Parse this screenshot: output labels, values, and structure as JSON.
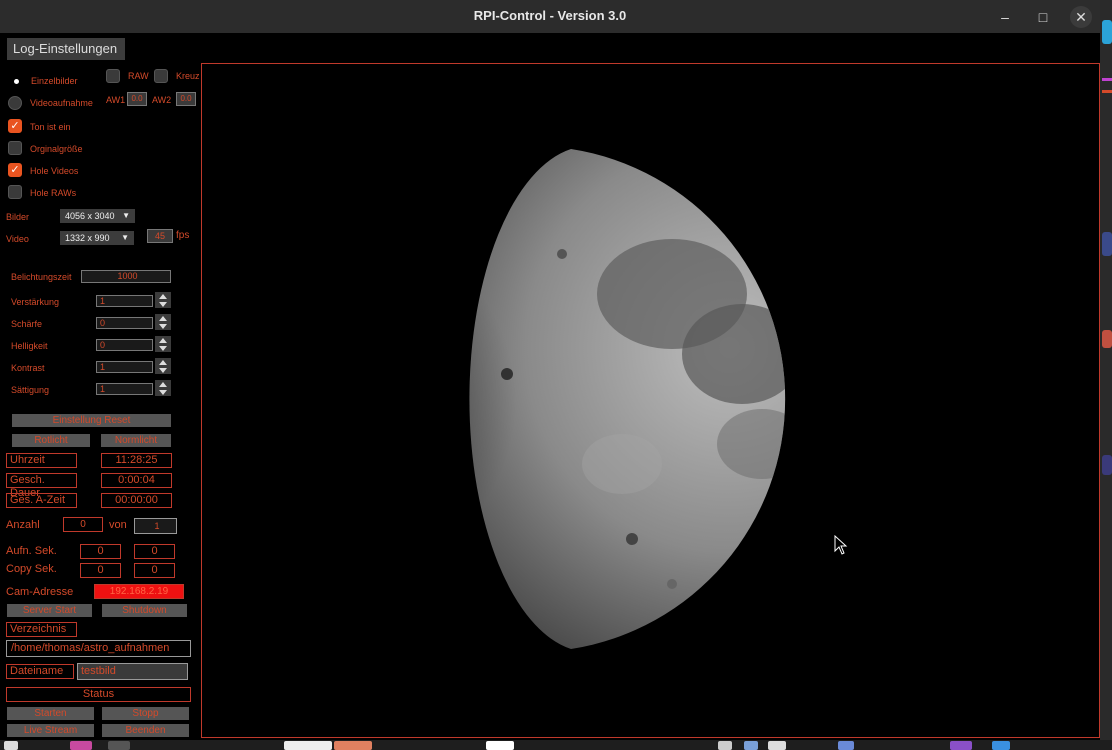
{
  "window": {
    "title": "RPI-Control - Version 3.0"
  },
  "menu": {
    "log_button": "Log-Einstellungen"
  },
  "mode": {
    "einzelbilder": "Einzelbilder",
    "videoaufnahme": "Videoaufnahme",
    "selected": "Einzelbilder"
  },
  "options": {
    "raw": "RAW",
    "kreuz": "Kreuz",
    "aw1_label": "AW1",
    "aw1_value": "0.0",
    "aw2_label": "AW2",
    "aw2_value": "0.0",
    "ton": "Ton ist ein",
    "original": "Orginalgröße",
    "hole_videos": "Hole Videos",
    "hole_raws": "Hole RAWs"
  },
  "resolution": {
    "bilder_label": "Bilder",
    "bilder_value": "4056 x 3040",
    "video_label": "Video",
    "video_value": "1332 x 990",
    "fps_value": "45",
    "fps_unit": "fps"
  },
  "settings": {
    "belichtung_label": "Belichtungszeit",
    "belichtung_value": "1000",
    "verstaerkung_label": "Verstärkung",
    "verstaerkung_value": "1",
    "schaerfe_label": "Schärfe",
    "schaerfe_value": "0",
    "helligkeit_label": "Helligkeit",
    "helligkeit_value": "0",
    "kontrast_label": "Kontrast",
    "kontrast_value": "1",
    "saettigung_label": "Sättigung",
    "saettigung_value": "1"
  },
  "buttons": {
    "reset": "Einstellung Reset",
    "rotlicht": "Rotlicht",
    "normlicht": "Normlicht",
    "server_start": "Server Start",
    "shutdown": "Shutdown",
    "starten": "Starten",
    "stopp": "Stopp",
    "live_stream": "Live Stream",
    "beenden": "Beenden"
  },
  "status": {
    "uhrzeit_label": "Uhrzeit",
    "uhrzeit_value": "11:28:25",
    "dauer_label": "Gesch. Dauer",
    "dauer_value": "0:00:04",
    "azeit_label": "Ges. A-Zeit",
    "azeit_value": "00:00:00",
    "anzahl_label": "Anzahl",
    "anzahl_value": "0",
    "von_label": "von",
    "von_value": "1",
    "aufn_label": "Aufn. Sek.",
    "aufn_v1": "0",
    "aufn_v2": "0",
    "copy_label": "Copy Sek.",
    "copy_v1": "0",
    "copy_v2": "0",
    "cam_label": "Cam-Adresse",
    "cam_value": "192.168.2.19",
    "verzeichnis_label": "Verzeichnis",
    "verzeichnis_value": "/home/thomas/astro_aufnahmen",
    "dateiname_label": "Dateiname",
    "dateiname_value": "testbild",
    "status_label": "Status"
  },
  "colors": {
    "accent": "#d44a2a",
    "check_on": "#e95420",
    "ip_fill": "#ee1111"
  }
}
